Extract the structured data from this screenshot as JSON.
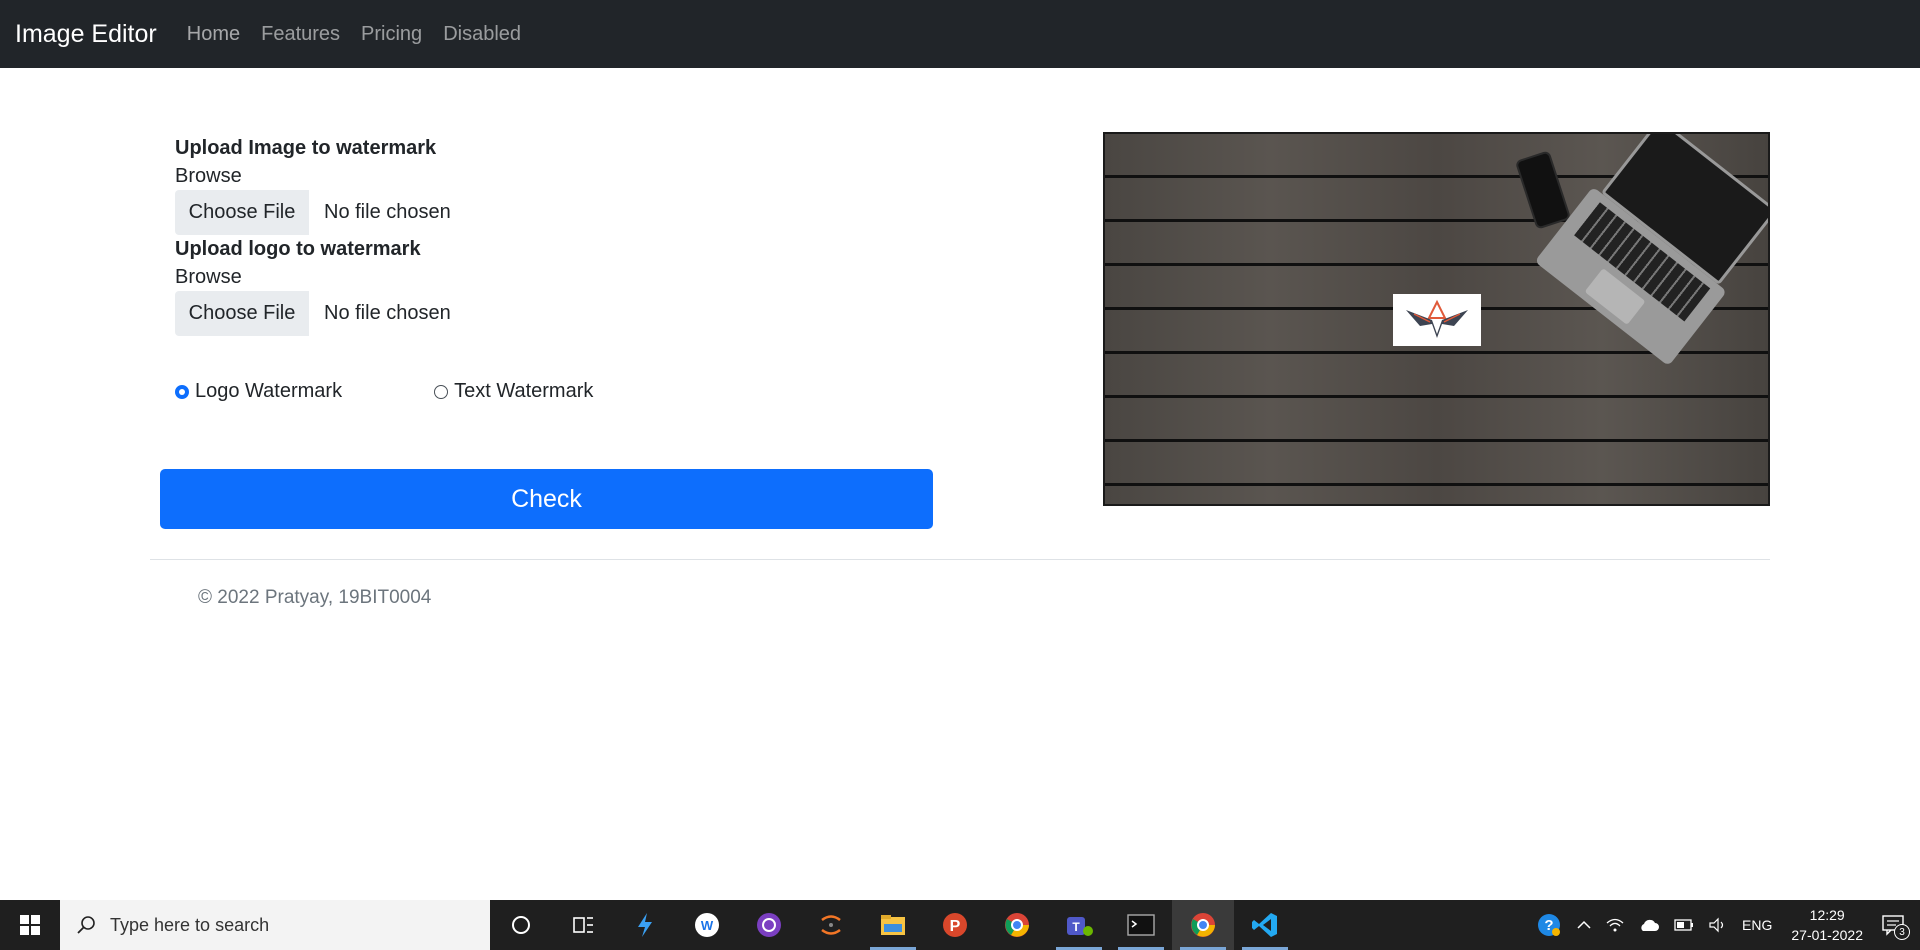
{
  "navbar": {
    "brand": "Image Editor",
    "links": [
      "Home",
      "Features",
      "Pricing",
      "Disabled"
    ]
  },
  "form": {
    "image_upload": {
      "title": "Upload Image to watermark",
      "browse_label": "Browse",
      "button_label": "Choose File",
      "status": "No file chosen"
    },
    "logo_upload": {
      "title": "Upload logo to watermark",
      "browse_label": "Browse",
      "button_label": "Choose File",
      "status": "No file chosen"
    },
    "radios": [
      {
        "label": "Logo Watermark",
        "checked": true
      },
      {
        "label": "Text Watermark",
        "checked": false
      }
    ],
    "submit_label": "Check"
  },
  "footer": {
    "text": "© 2022 Pratyay, 19BIT0004"
  },
  "taskbar": {
    "search_placeholder": "Type here to search",
    "apps": [
      "task-view-icon",
      "azure-data-studio-icon",
      "onenote-icon",
      "github-desktop-icon",
      "jupyter-icon",
      "file-explorer-icon",
      "postman-icon",
      "chrome-icon",
      "teams-icon",
      "terminal-icon",
      "chrome-icon",
      "vscode-icon"
    ],
    "language": "ENG",
    "time": "12:29",
    "date": "27-01-2022",
    "notifications": "3"
  },
  "colors": {
    "navbar_bg": "#212529",
    "primary": "#0d6efd",
    "taskbar_bg": "#1f1f1f"
  }
}
